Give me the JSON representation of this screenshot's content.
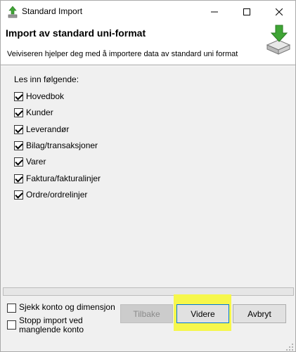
{
  "window": {
    "title": "Standard Import",
    "controls": {
      "minimize": "minimize-icon",
      "maximize": "maximize-icon",
      "close": "close-icon"
    }
  },
  "header": {
    "title": "Import av standard uni-format",
    "subtitle": "Veiviseren hjelper deg med å importere data av standard uni format",
    "icon": "import-download-icon"
  },
  "content": {
    "lead": "Les inn følgende:",
    "items": [
      {
        "label": "Hovedbok",
        "checked": true
      },
      {
        "label": "Kunder",
        "checked": true
      },
      {
        "label": "Leverandør",
        "checked": true
      },
      {
        "label": "Bilag/transaksjoner",
        "checked": true
      },
      {
        "label": "Varer",
        "checked": true
      },
      {
        "label": "Faktura/fakturalinjer",
        "checked": true
      },
      {
        "label": "Ordre/ordrelinjer",
        "checked": true
      }
    ]
  },
  "progress": {
    "value": 0
  },
  "footer": {
    "check_account": {
      "label": "Sjekk konto og dimensjon",
      "checked": false
    },
    "stop_import": {
      "label_line1": "Stopp import ved",
      "label_line2": "manglende konto",
      "checked": false
    },
    "back_label": "Tilbake",
    "next_label": "Videre",
    "cancel_label": "Avbryt"
  },
  "colors": {
    "highlight": "#f6f74b",
    "default_button_border": "#0078d7",
    "icon_green": "#3fa535"
  }
}
